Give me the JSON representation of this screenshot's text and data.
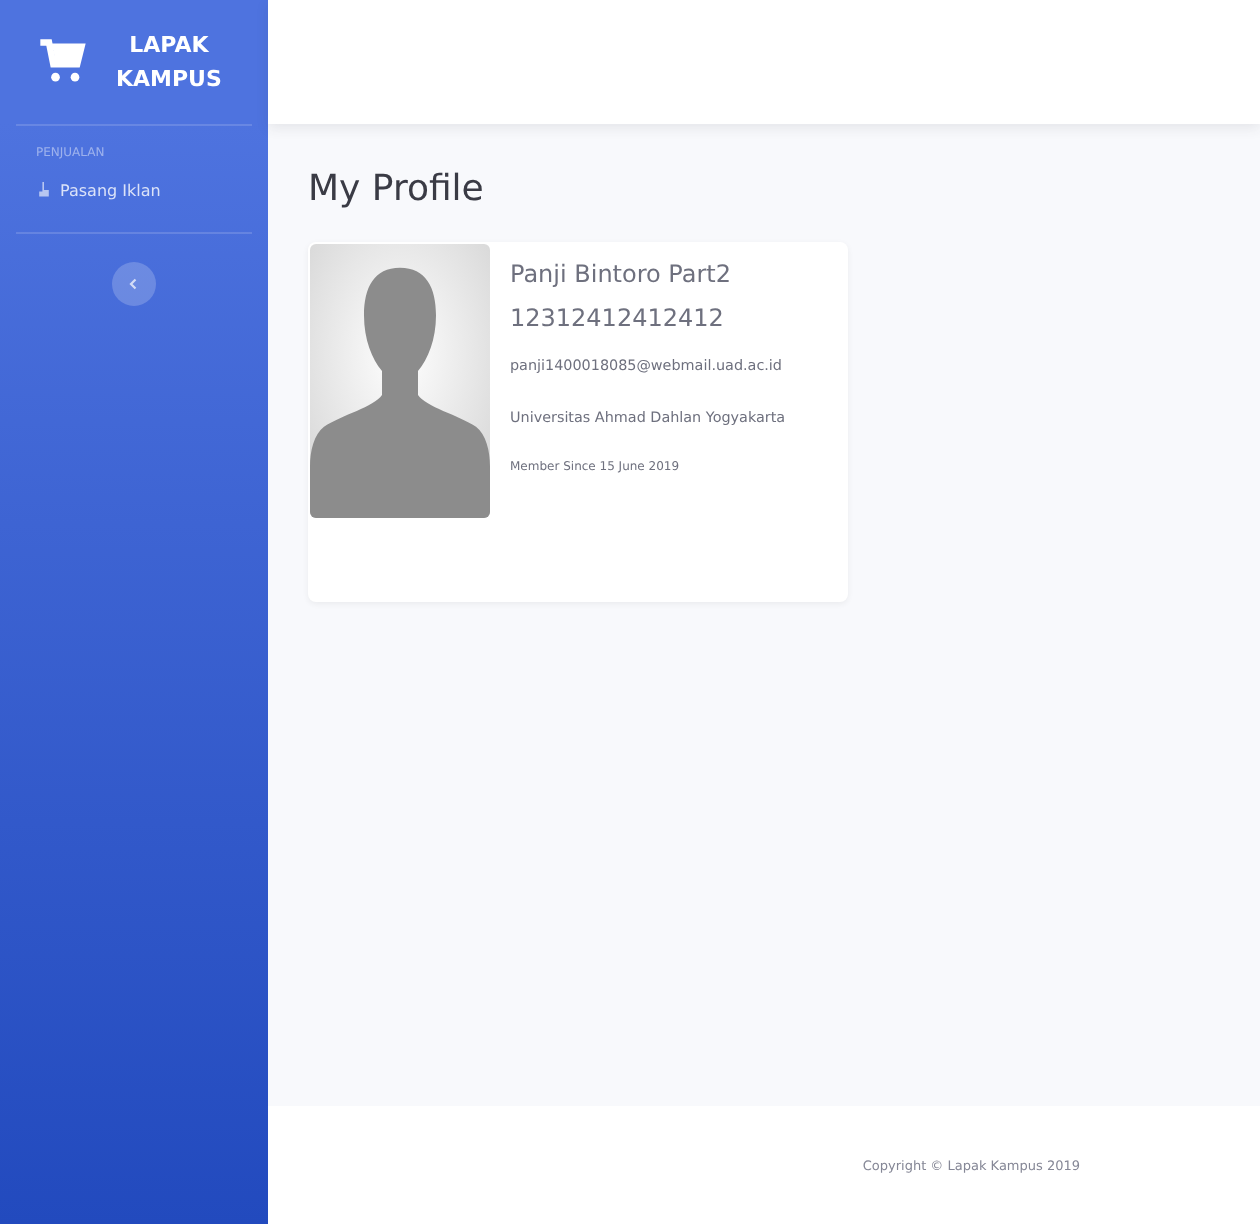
{
  "brand": {
    "line_1": "LAPAK",
    "line_2": "KAMPUS"
  },
  "sidebar": {
    "heading": "PENJUALAN",
    "items": [
      {
        "label": "Pasang Iklan"
      }
    ]
  },
  "page_title": "My Profile",
  "profile": {
    "name": "Panji Bintoro Part2",
    "number": "12312412412412",
    "email": "panji1400018085@webmail.uad.ac.id",
    "university": "Universitas Ahmad Dahlan Yogyakarta",
    "member_since": "Member Since 15 June 2019"
  },
  "footer": "Copyright © Lapak Kampus 2019"
}
